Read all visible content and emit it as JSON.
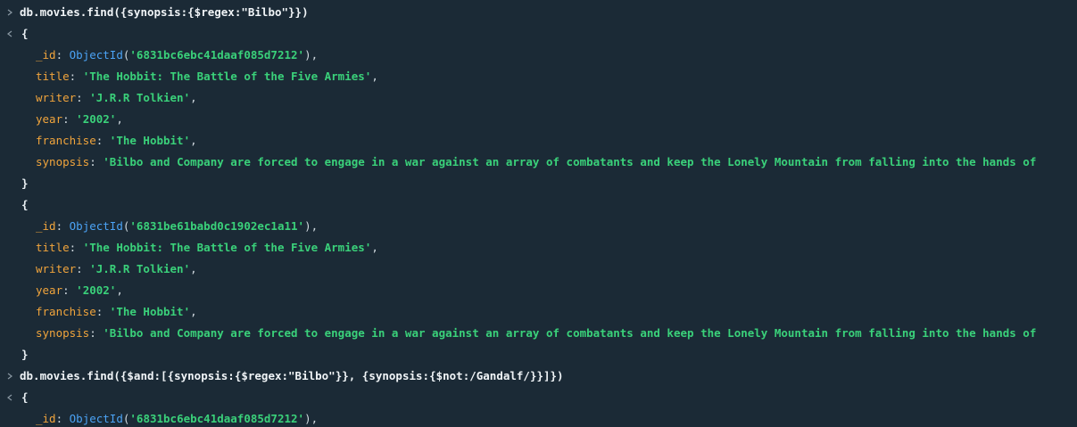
{
  "colors": {
    "background": "#1b2a36",
    "key": "#f0a43c",
    "string": "#3ad17a",
    "function": "#4ba3f5",
    "text": "#e8eef2"
  },
  "icons": {
    "input": "chevron-right-icon",
    "output": "chevron-left-icon"
  },
  "query1": {
    "command": "db.movies.find({synopsis:{$regex:\"Bilbo\"}})"
  },
  "doc1": {
    "open": "{",
    "close": "}",
    "id_key": "_id",
    "id_fn": "ObjectId",
    "id_value": "'6831bc6ebc41daaf085d7212'",
    "title_key": "title",
    "title_value": "'The Hobbit: The Battle of the Five Armies'",
    "writer_key": "writer",
    "writer_value": "'J.R.R Tolkien'",
    "year_key": "year",
    "year_value": "'2002'",
    "franchise_key": "franchise",
    "franchise_value": "'The Hobbit'",
    "synopsis_key": "synopsis",
    "synopsis_value": "'Bilbo and Company are forced to engage in a war against an array of combatants and keep the Lonely Mountain from falling into the hands of"
  },
  "doc2": {
    "open": "{",
    "close": "}",
    "id_key": "_id",
    "id_fn": "ObjectId",
    "id_value": "'6831be61babd0c1902ec1a11'",
    "title_key": "title",
    "title_value": "'The Hobbit: The Battle of the Five Armies'",
    "writer_key": "writer",
    "writer_value": "'J.R.R Tolkien'",
    "year_key": "year",
    "year_value": "'2002'",
    "franchise_key": "franchise",
    "franchise_value": "'The Hobbit'",
    "synopsis_key": "synopsis",
    "synopsis_value": "'Bilbo and Company are forced to engage in a war against an array of combatants and keep the Lonely Mountain from falling into the hands of"
  },
  "query2": {
    "command": "db.movies.find({$and:[{synopsis:{$regex:\"Bilbo\"}}, {synopsis:{$not:/Gandalf/}}]})"
  },
  "doc3": {
    "open": "{",
    "id_key": "_id",
    "id_fn": "ObjectId",
    "id_value": "'6831bc6ebc41daaf085d7212'"
  }
}
